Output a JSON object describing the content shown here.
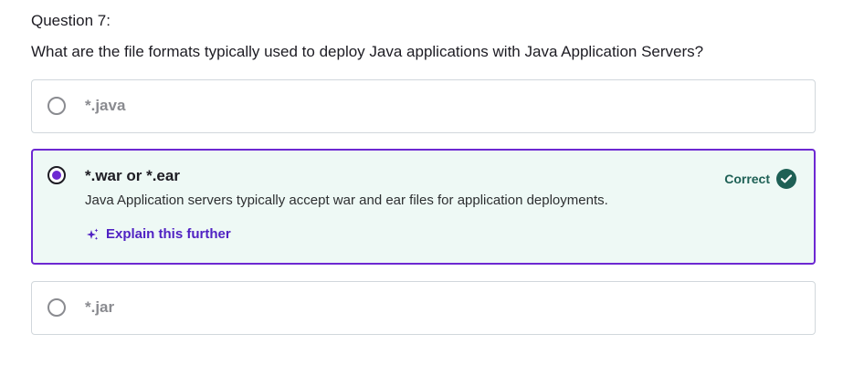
{
  "question": {
    "number": "Question 7:",
    "text": "What are the file formats typically used to deploy Java applications with Java Application Servers?"
  },
  "options": [
    {
      "label": "*.java",
      "selected": false
    },
    {
      "label": "*.war or *.ear",
      "selected": true,
      "status": "Correct",
      "explanation": "Java Application servers typically accept war and ear files for application deployments.",
      "explain_link": "Explain this further"
    },
    {
      "label": "*.jar",
      "selected": false
    }
  ],
  "colors": {
    "accent": "#6d28d2",
    "correct": "#1e6055",
    "correct_bg": "#eef9f5",
    "link": "#5022c3"
  },
  "icons": {
    "check": "check-circle-icon",
    "sparkle": "sparkle-icon"
  }
}
